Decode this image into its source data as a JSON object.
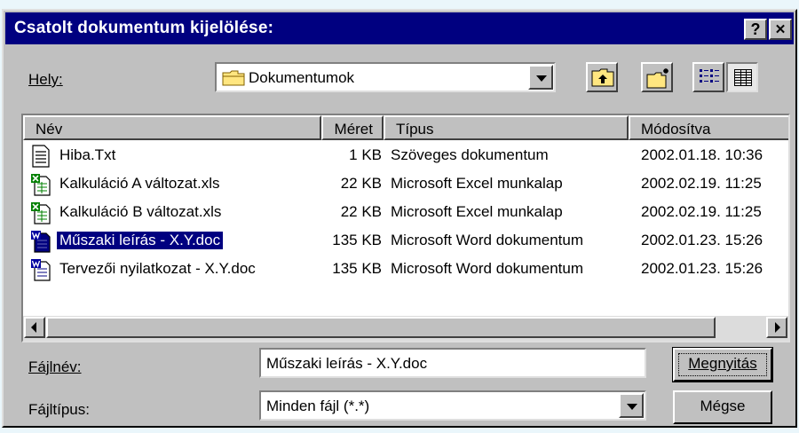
{
  "dialog": {
    "title": "Csatolt dokumentum kijelölése:",
    "help_label": "?",
    "close_label": "✕"
  },
  "location": {
    "label": "Hely:",
    "value": "Dokumentumok"
  },
  "file_list": {
    "columns": [
      "Név",
      "Méret",
      "Típus",
      "Módosítva"
    ],
    "rows": [
      {
        "name": "Hiba.Txt",
        "size": "1 KB",
        "type": "Szöveges dokumentum",
        "modified": "2002.01.18. 10:36",
        "icon": "text-file-icon"
      },
      {
        "name": "Kalkuláció A változat.xls",
        "size": "22 KB",
        "type": "Microsoft Excel munkalap",
        "modified": "2002.02.19. 11:25",
        "icon": "excel-file-icon"
      },
      {
        "name": "Kalkuláció B változat.xls",
        "size": "22 KB",
        "type": "Microsoft Excel munkalap",
        "modified": "2002.02.19. 11:25",
        "icon": "excel-file-icon"
      },
      {
        "name": "Műszaki leírás - X.Y.doc",
        "size": "135 KB",
        "type": "Microsoft Word dokumentum",
        "modified": "2002.01.23. 15:26",
        "icon": "word-file-icon",
        "selected": true
      },
      {
        "name": "Tervezői nyilatkozat - X.Y.doc",
        "size": "135 KB",
        "type": "Microsoft Word dokumentum",
        "modified": "2002.01.23. 15:26",
        "icon": "word-file-icon"
      }
    ]
  },
  "filename": {
    "label": "Fájlnév:",
    "value": "Műszaki leírás - X.Y.doc"
  },
  "filetype": {
    "label": "Fájltípus:",
    "value": "Minden fájl (*.*)"
  },
  "buttons": {
    "open": "Megnyitás",
    "cancel": "Mégse"
  },
  "colors": {
    "titlebar": "#000080",
    "face": "#c0c0c0",
    "selection": "#000080"
  }
}
